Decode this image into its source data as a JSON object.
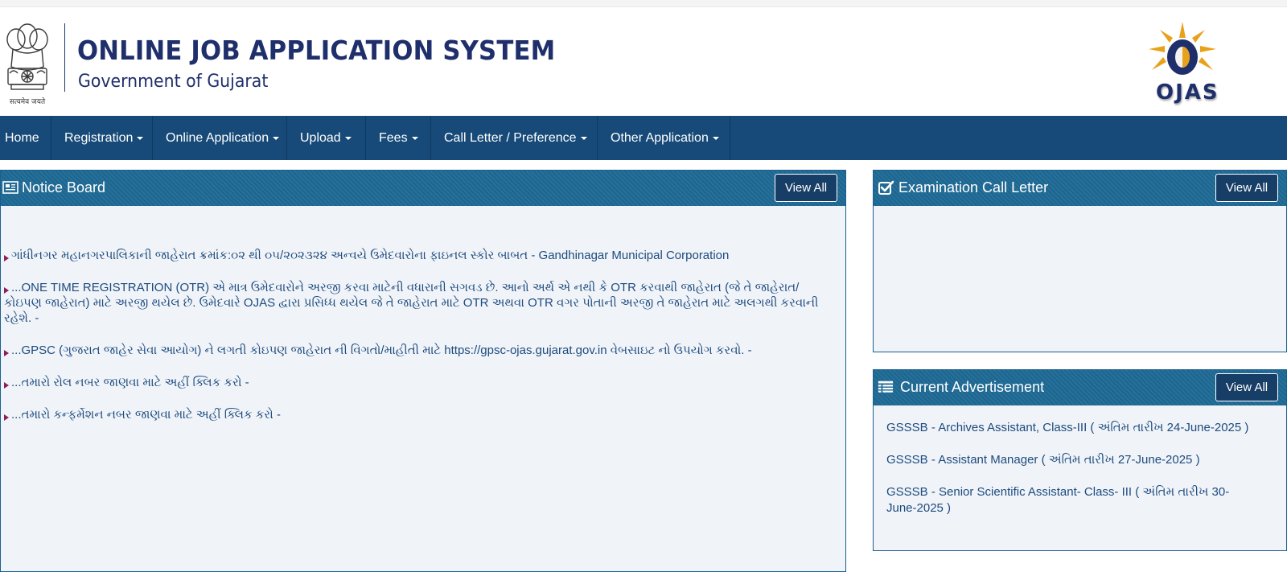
{
  "header": {
    "emblem_caption": "सत्यमेव जयते",
    "title": "ONLINE JOB APPLICATION SYSTEM",
    "subtitle": "Government of Gujarat",
    "logo_text": "OJAS"
  },
  "nav": {
    "items": [
      {
        "label": "Home",
        "dropdown": false
      },
      {
        "label": "Registration",
        "dropdown": true
      },
      {
        "label": "Online Application",
        "dropdown": true
      },
      {
        "label": "Upload",
        "dropdown": true
      },
      {
        "label": "Fees",
        "dropdown": true
      },
      {
        "label": "Call Letter / Preference",
        "dropdown": true
      },
      {
        "label": "Other Application",
        "dropdown": true
      }
    ]
  },
  "notice_board": {
    "title": "Notice Board",
    "view_all": "View All",
    "icon": "newspaper-icon",
    "items": [
      "ગાંધીનગર મહાનગરપાલિકાની જાહેરાત ક્રમાંક:૦૨ થી ૦૫/૨૦૨૩૨૪ અન્વયે ઉમેદવારોના ફાઇનલ સ્કોર બાબત - Gandhinagar Municipal Corporation",
      "...ONE TIME REGISTRATION (OTR) એ માત્ર ઉમેદવારોને અરજી કરવા માટેની વધારાની સગવડ છે. આનો અર્થ એ નથી કે OTR કરવાથી જાહેરાત (જે તે જાહેરાત/કોઇપણ જાહેરાત) માટે અરજી થયેલ છે. ઉમેદવારે OJAS દ્વારા પ્રસિધ્ધ થયેલ જે તે જાહેરાત માટે OTR અથવા OTR વગર પોતાની અરજી તે જાહેરાત માટે અલગથી કરવાની રહેશે. -",
      "...GPSC (ગુજરાત જાહેર સેવા આયોગ) ને લગતી કોઇપણ જાહેરાત ની વિગતો/માહીતી માટે https://gpsc-ojas.gujarat.gov.in વેબસાઇટ નો ઉપયોગ કરવો. -",
      "...તમારો રોલ નબર જાણવા માટે અહીં ક્લિક કરો -",
      "...તમારો કન્ફર્મેશન નબર જાણવા માટે અહીં ક્લિક કરો -"
    ]
  },
  "exam_call_letter": {
    "title": "Examination Call Letter",
    "view_all": "View All",
    "icon": "checkbox-icon"
  },
  "current_advertisement": {
    "title": "Current Advertisement",
    "view_all": "View All",
    "icon": "list-icon",
    "items": [
      "GSSSB - Archives Assistant, Class-III ( અંતિમ તારીખ 24-June-2025 )",
      "GSSSB - Assistant Manager ( અંતિમ તારીખ 27-June-2025 )",
      "GSSSB - Senior Scientific Assistant- Class- III ( અંતિમ તારીખ 30-June-2025 )"
    ]
  },
  "colors": {
    "nav_bg": "#174a78",
    "panel_head": "#1e6a96",
    "link_text": "#1d4a7d",
    "title_navy": "#1f2f6b",
    "bullet": "#8a1f5a"
  }
}
